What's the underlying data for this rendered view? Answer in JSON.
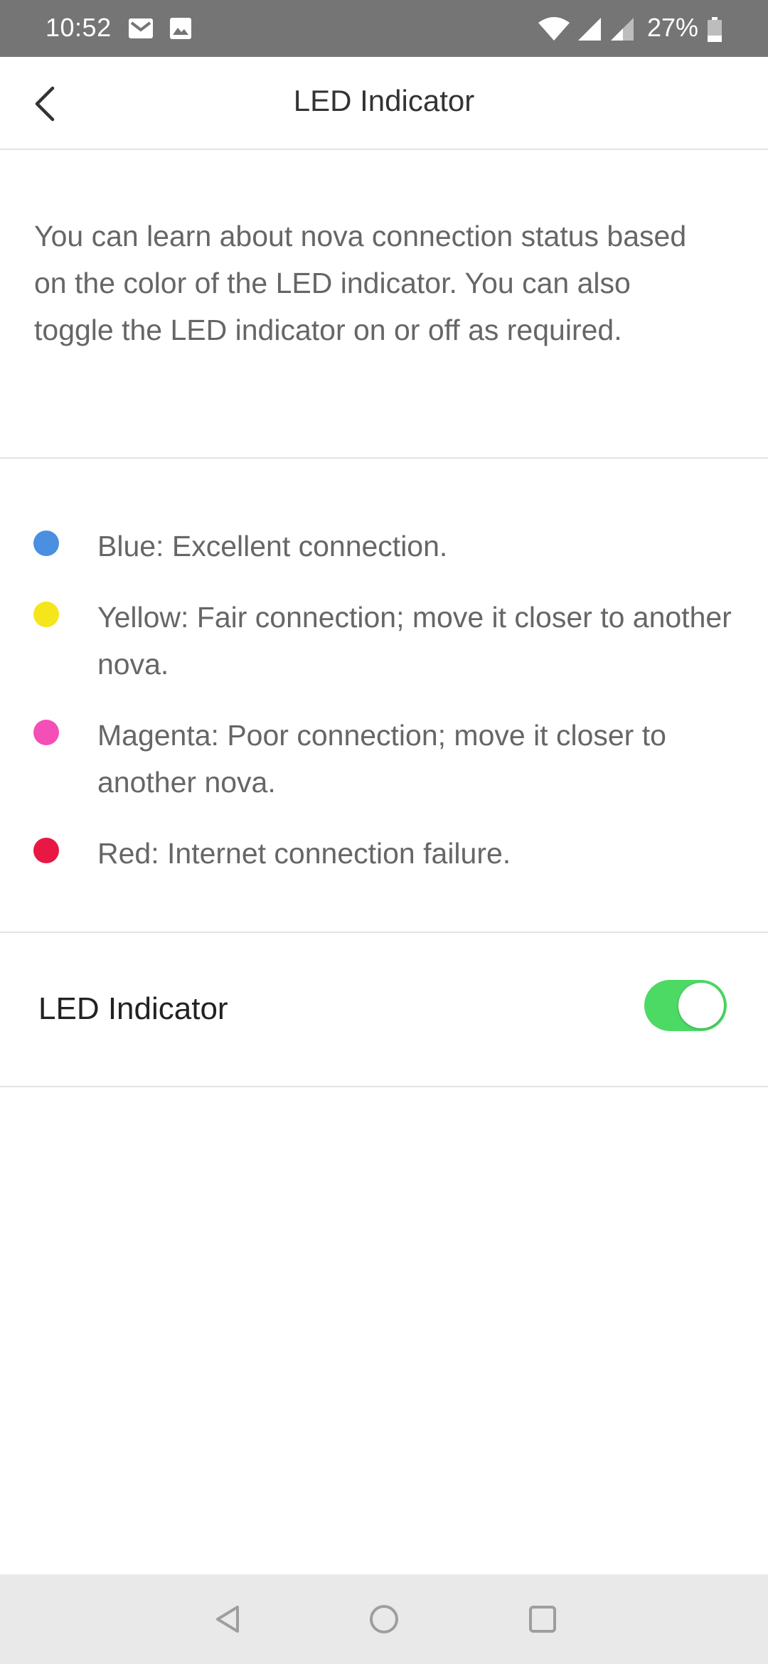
{
  "status_bar": {
    "time": "10:52",
    "battery": "27%",
    "icons": [
      "gmail-icon",
      "image-icon",
      "wifi-icon",
      "signal-icon",
      "signal-icon",
      "battery-icon"
    ]
  },
  "header": {
    "title": "LED Indicator",
    "back_icon": "chevron-left-icon"
  },
  "intro": {
    "text": "You can learn about nova connection status based on the color of the LED indicator. You can also toggle the LED indicator on or off as required."
  },
  "legend": {
    "items": [
      {
        "color": "#4a8fe0",
        "text": "Blue: Excellent connection."
      },
      {
        "color": "#f5e51b",
        "text": "Yellow: Fair connection; move it closer to another nova."
      },
      {
        "color": "#f44fb6",
        "text": "Magenta: Poor connection; move it closer to another nova."
      },
      {
        "color": "#e81743",
        "text": "Red: Internet connection failure."
      }
    ]
  },
  "setting": {
    "label": "LED Indicator",
    "enabled": true,
    "on_color": "#4cd964"
  },
  "nav_bar": {
    "icons": [
      "back-triangle-icon",
      "home-circle-icon",
      "recents-square-icon"
    ]
  }
}
